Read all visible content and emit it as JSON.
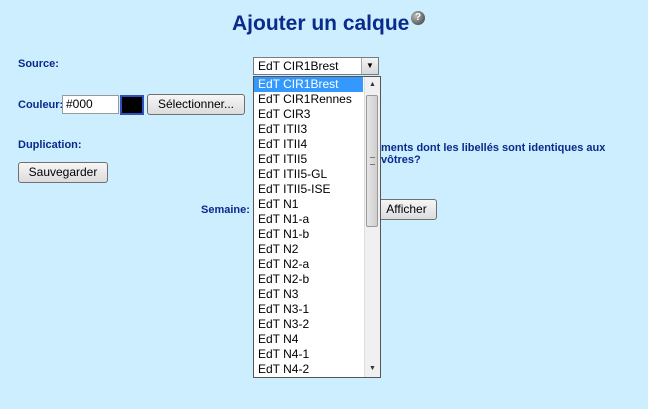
{
  "header": {
    "title": "Ajouter un calque",
    "help_symbol": "?"
  },
  "icons": {
    "help": "help-icon",
    "dropdown_arrow": "chevron-down-icon"
  },
  "source": {
    "label": "Source:",
    "selected": "EdT CIR1Brest"
  },
  "couleur": {
    "label": "Couleur:",
    "value": "#000",
    "swatch_color": "#000000",
    "select_button": "Sélectionner..."
  },
  "duplication": {
    "label": "Duplication:",
    "text": "ments dont les libellés sont identiques aux vôtres?"
  },
  "save_button": "Sauvegarder",
  "semaine": {
    "label": "Semaine:",
    "show_button": "Afficher"
  },
  "dropdown": {
    "options": [
      "EdT CIR1Brest",
      "EdT CIR1Rennes",
      "EdT CIR3",
      "EdT ITII3",
      "EdT ITII4",
      "EdT ITII5",
      "EdT ITII5-GL",
      "EdT ITII5-ISE",
      "EdT N1",
      "EdT N1-a",
      "EdT N1-b",
      "EdT N2",
      "EdT N2-a",
      "EdT N2-b",
      "EdT N3",
      "EdT N3-1",
      "EdT N3-2",
      "EdT N4",
      "EdT N4-1",
      "EdT N4-2"
    ],
    "selected_index": 0
  }
}
